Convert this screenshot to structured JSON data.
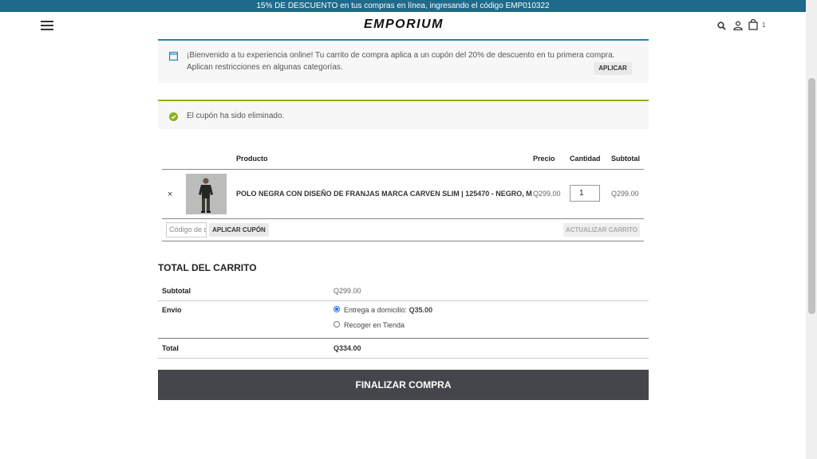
{
  "promo_bar": {
    "text": "15% DE DESCUENTO en tus compras en línea, ingresando el código EMP010322"
  },
  "header": {
    "logo": "EMPORIUM",
    "menu_icon": "hamburger-menu-icon",
    "search_icon": "search-icon",
    "account_icon": "user-icon",
    "cart_icon": "shopping-bag-icon",
    "cart_count": "1"
  },
  "info_notice": {
    "icon": "browser-window-icon",
    "text": "¡Bienvenido a tu experiencia online! Tu carrito de compra aplica a un cupón del 20% de descuento en tu primera compra. Aplican restricciones en algunas categorías.",
    "button": "APLICAR",
    "accent_color": "#1e85be"
  },
  "success_notice": {
    "icon": "check-circle-icon",
    "text": "El cupón ha sido eliminado.",
    "accent_color": "#8fae1b"
  },
  "cart": {
    "columns": {
      "product": "Producto",
      "price": "Precio",
      "quantity": "Cantidad",
      "subtotal": "Subtotal"
    },
    "items": [
      {
        "remove": "×",
        "name": "POLO NEGRA CON DISEÑO DE FRANJAS MARCA CARVEN SLIM | 125470 - NEGRO, M",
        "price": "Q299.00",
        "quantity": "1",
        "subtotal": "Q299.00"
      }
    ],
    "coupon_placeholder": "Código de cupón",
    "apply_coupon": "APLICAR CUPÓN",
    "update_cart": "ACTUALIZAR CARRITO"
  },
  "totals": {
    "title": "TOTAL DEL CARRITO",
    "subtotal_label": "Subtotal",
    "subtotal_value": "Q299.00",
    "shipping_label": "Envío",
    "shipping_options": [
      {
        "label": "Entrega a domicilio:",
        "price": "Q35.00",
        "selected": true
      },
      {
        "label": "Recoger en Tienda",
        "selected": false
      }
    ],
    "total_label": "Total",
    "total_value": "Q334.00"
  },
  "checkout_button": "FINALIZAR COMPRA"
}
